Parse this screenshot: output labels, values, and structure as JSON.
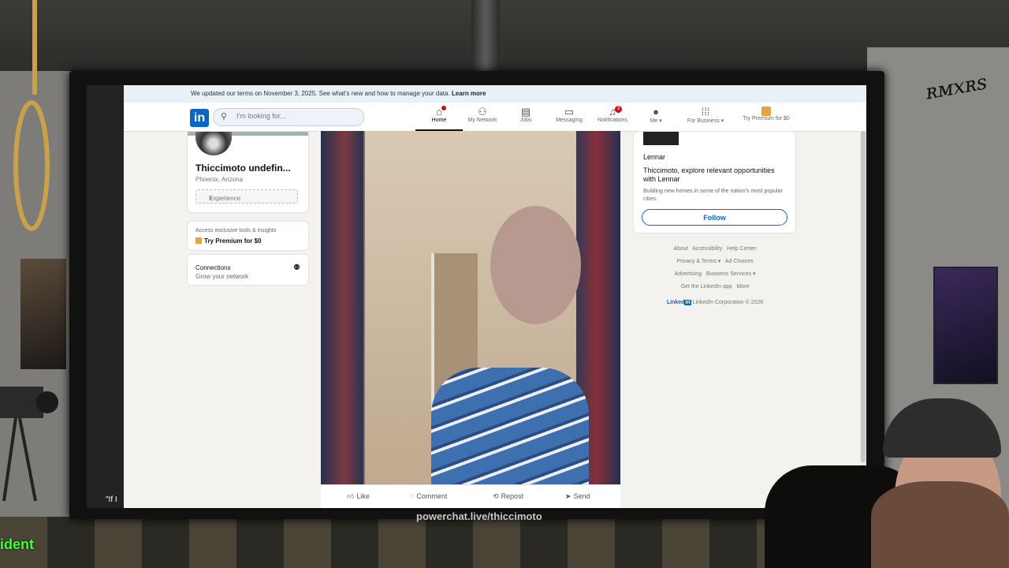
{
  "stream": {
    "caption": "powerchat.live/thiccimoto",
    "side_label": "ident",
    "side_quote": "\"If I"
  },
  "banner": {
    "text": "We updated our terms on November 3, 2025. See what's new and how to manage your data.",
    "link": "Learn more"
  },
  "nav": {
    "logo": "in",
    "search_placeholder": "I'm looking for...",
    "items": [
      {
        "label": "Home",
        "icon": "home-icon",
        "glyph": "⌂",
        "badge": ""
      },
      {
        "label": "My Network",
        "icon": "network-icon",
        "glyph": "👥",
        "badge": ""
      },
      {
        "label": "Jobs",
        "icon": "briefcase-icon",
        "glyph": "💼",
        "badge": ""
      },
      {
        "label": "Messaging",
        "icon": "message-icon",
        "glyph": "💬",
        "badge": ""
      },
      {
        "label": "Notifications",
        "icon": "bell-icon",
        "glyph": "🔔",
        "badge": "3"
      },
      {
        "label": "Me ▾",
        "icon": "avatar-icon",
        "glyph": "●",
        "badge": ""
      },
      {
        "label": "For Business ▾",
        "icon": "grid-icon",
        "glyph": "⋮⋮⋮",
        "badge": ""
      },
      {
        "label": "Try Premium for $0",
        "icon": "premium-icon",
        "glyph": "",
        "badge": ""
      }
    ]
  },
  "profile": {
    "name": "Thiccimoto undefin...",
    "location": "Phoenix, Arizona",
    "experience_label": "Experience"
  },
  "premium_card": {
    "line1": "Access exclusive tools & insights",
    "line2": "Try Premium for $0"
  },
  "connections": {
    "title": "Connections",
    "subtitle": "Grow your network"
  },
  "post_actions": {
    "like": "Like",
    "comment": "Comment",
    "repost": "Repost",
    "send": "Send"
  },
  "ad": {
    "company": "Lennar",
    "text": "Thiccimoto, explore relevant opportunities with Lennar",
    "sub": "Building new homes in some of the nation's most popular cities.",
    "follow": "Follow"
  },
  "footer": {
    "links_row1": [
      "About",
      "Accessibility",
      "Help Center"
    ],
    "links_row2": [
      "Privacy & Terms ▾",
      "Ad Choices"
    ],
    "links_row3": [
      "Advertising",
      "Business Services ▾"
    ],
    "links_row4": [
      "Get the LinkedIn app",
      "More"
    ],
    "brand": "Linked",
    "brand_in": "in",
    "copyright": "LinkedIn Corporation © 2026"
  }
}
